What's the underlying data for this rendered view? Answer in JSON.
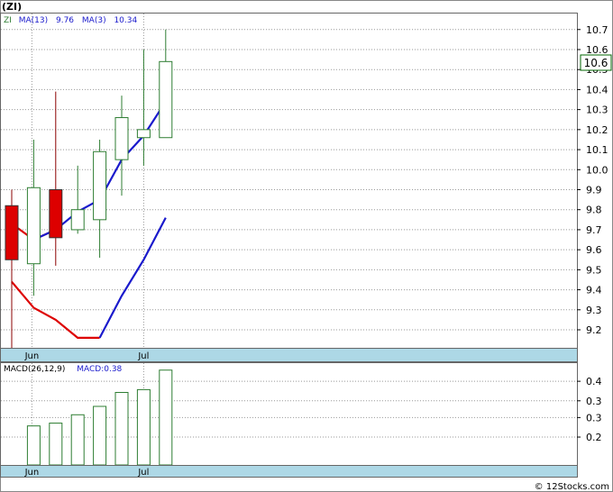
{
  "title": "(ZI)",
  "footer": "© 12Stocks.com",
  "colors": {
    "up": "#2e7d32",
    "down": "#dd0000",
    "ma13": "#dd0000",
    "ma3": "#1a1acc",
    "axis_band": "#add8e6",
    "current_price_box": "#006400"
  },
  "chart_data": [
    {
      "type": "candlestick",
      "legend": {
        "ticker": "ZI",
        "ma13_label": "MA(13)",
        "ma13_value": "9.76",
        "ma3_label": "MA(3)",
        "ma3_value": "10.34"
      },
      "current_price": "10.6",
      "ylim": [
        9.11,
        10.78
      ],
      "yticks": [
        9.2,
        9.3,
        9.4,
        9.5,
        9.6,
        9.7,
        9.8,
        9.9,
        10.0,
        10.1,
        10.2,
        10.3,
        10.4,
        10.5,
        10.6,
        10.7
      ],
      "xtick_labels": [
        {
          "label": "Jun",
          "index": 1
        },
        {
          "label": "Jul",
          "index": 6
        }
      ],
      "candles": [
        {
          "open": 9.82,
          "close": 9.55,
          "high": 9.9,
          "low": 9.11
        },
        {
          "open": 9.53,
          "close": 9.91,
          "high": 10.15,
          "low": 9.37
        },
        {
          "open": 9.9,
          "close": 9.66,
          "high": 10.39,
          "low": 9.52
        },
        {
          "open": 9.7,
          "close": 9.8,
          "high": 10.02,
          "low": 9.68
        },
        {
          "open": 9.75,
          "close": 10.09,
          "high": 10.15,
          "low": 9.56
        },
        {
          "open": 10.05,
          "close": 10.26,
          "high": 10.37,
          "low": 9.87
        },
        {
          "open": 10.16,
          "close": 10.2,
          "high": 10.6,
          "low": 10.02
        },
        {
          "open": 10.16,
          "close": 10.54,
          "high": 10.7,
          "low": 10.16
        }
      ],
      "ma13": [
        9.44,
        9.31,
        9.25,
        9.16,
        9.16,
        9.37,
        9.55,
        9.76
      ],
      "ma3": [
        9.73,
        9.65,
        9.7,
        9.79,
        9.85,
        10.05,
        10.17,
        10.34
      ]
    },
    {
      "type": "bar",
      "legend": {
        "label": "MACD(26,12,9)",
        "value_label": "MACD:0.38"
      },
      "ylim": [
        0.1,
        0.465
      ],
      "yticks": [
        0.2,
        0.3,
        0.3,
        0.4
      ],
      "ytick_values": [
        0.2,
        0.27,
        0.33,
        0.4
      ],
      "xtick_labels": [
        {
          "label": "Jun",
          "index": 1
        },
        {
          "label": "Jul",
          "index": 6
        }
      ],
      "values": [
        0.0,
        0.24,
        0.25,
        0.28,
        0.31,
        0.36,
        0.37,
        0.44
      ]
    }
  ]
}
